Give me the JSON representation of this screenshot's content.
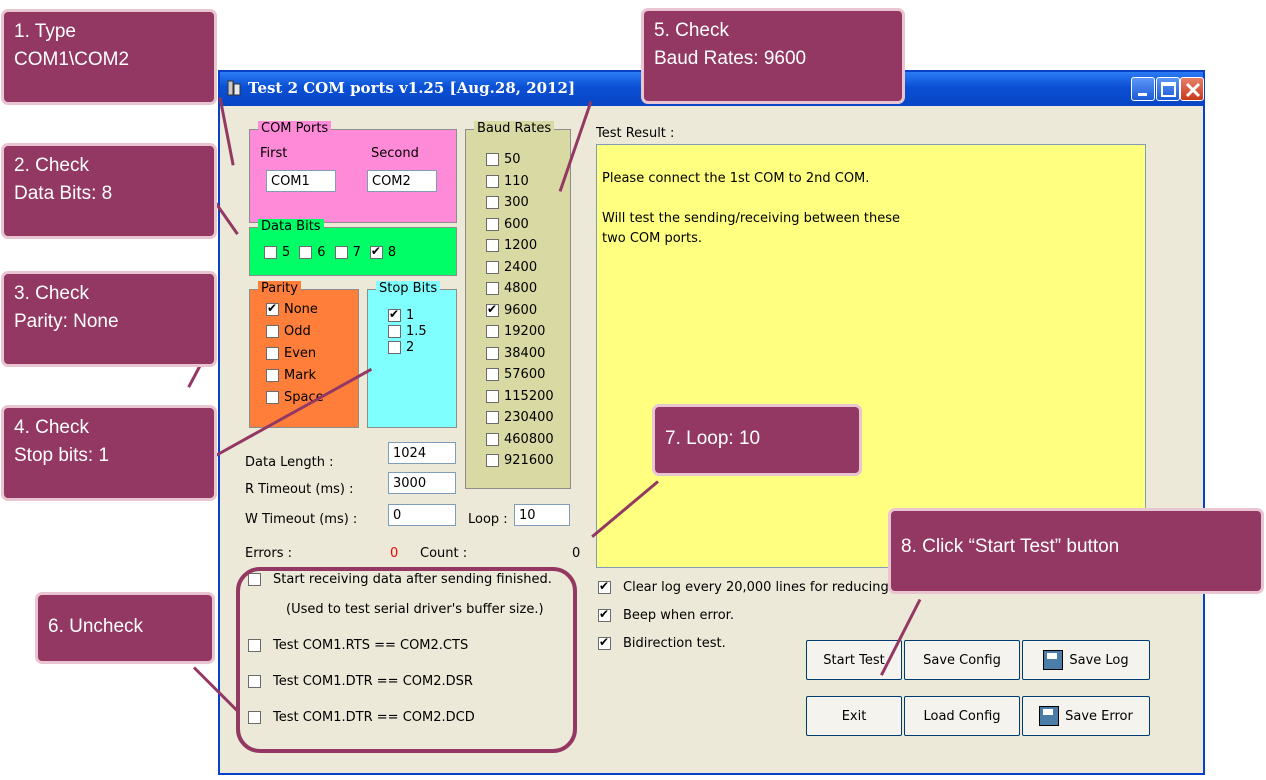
{
  "window": {
    "title": "Test 2 COM ports v1.25 [Aug.28, 2012]",
    "icon": "app-icon",
    "controls": [
      "minimize-icon",
      "maximize-icon",
      "close-icon"
    ]
  },
  "com_ports": {
    "label": "COM Ports",
    "first_label": "First",
    "second_label": "Second",
    "first_value": "COM1",
    "second_value": "COM2",
    "color": "#ff8ad8"
  },
  "data_bits": {
    "label": "Data Bits",
    "options": [
      {
        "label": "5",
        "checked": false
      },
      {
        "label": "6",
        "checked": false
      },
      {
        "label": "7",
        "checked": false
      },
      {
        "label": "8",
        "checked": true
      }
    ],
    "color": "#00ff66"
  },
  "parity": {
    "label": "Parity",
    "options": [
      {
        "label": "None",
        "checked": true
      },
      {
        "label": "Odd",
        "checked": false
      },
      {
        "label": "Even",
        "checked": false
      },
      {
        "label": "Mark",
        "checked": false
      },
      {
        "label": "Space",
        "checked": false
      }
    ],
    "color": "#ff7f3a"
  },
  "stop_bits": {
    "label": "Stop Bits",
    "options": [
      {
        "label": "1",
        "checked": true
      },
      {
        "label": "1.5",
        "checked": false
      },
      {
        "label": "2",
        "checked": false
      }
    ],
    "color": "#80ffff"
  },
  "baud_rates": {
    "label": "Baud Rates",
    "options": [
      {
        "label": "50",
        "checked": false
      },
      {
        "label": "110",
        "checked": false
      },
      {
        "label": "300",
        "checked": false
      },
      {
        "label": "600",
        "checked": false
      },
      {
        "label": "1200",
        "checked": false
      },
      {
        "label": "2400",
        "checked": false
      },
      {
        "label": "4800",
        "checked": false
      },
      {
        "label": "9600",
        "checked": true
      },
      {
        "label": "19200",
        "checked": false
      },
      {
        "label": "38400",
        "checked": false
      },
      {
        "label": "57600",
        "checked": false
      },
      {
        "label": "115200",
        "checked": false
      },
      {
        "label": "230400",
        "checked": false
      },
      {
        "label": "460800",
        "checked": false
      },
      {
        "label": "921600",
        "checked": false
      }
    ],
    "color": "#d9d9a3"
  },
  "timing": {
    "data_length_label": "Data Length :",
    "data_length_value": "1024",
    "r_timeout_label": "R Timeout (ms) :",
    "r_timeout_value": "3000",
    "w_timeout_label": "W Timeout (ms) :",
    "w_timeout_value": "0"
  },
  "loop": {
    "label": "Loop :",
    "value": "10"
  },
  "stats": {
    "errors_label": "Errors :",
    "errors_value": "0",
    "count_label": "Count :",
    "count_value": "0",
    "errors_color": "#ff0000"
  },
  "test_result": {
    "label": "Test Result :",
    "lines": [
      "",
      "Please connect the 1st COM to 2nd COM.",
      "",
      "Will test the sending/receiving between these",
      "two COM ports."
    ],
    "color": "#ffff80"
  },
  "options_left": [
    {
      "label": "Start receiving data after sending finished.",
      "checked": false
    },
    {
      "label": "(Used to test serial driver's buffer size.)",
      "checked": null
    },
    {
      "label": "Test COM1.RTS == COM2.CTS",
      "checked": false
    },
    {
      "label": "Test COM1.DTR == COM2.DSR",
      "checked": false
    },
    {
      "label": "Test COM1.DTR == COM2.DCD",
      "checked": false
    }
  ],
  "options_right": [
    {
      "label": "Clear log every 20,000  lines for reducing memory usage.",
      "checked": true
    },
    {
      "label": "Beep when error.",
      "checked": true
    },
    {
      "label": "Bidirection test.",
      "checked": true
    }
  ],
  "buttons": {
    "start_test": "Start Test",
    "save_config": "Save Config",
    "save_log": "Save Log",
    "exit": "Exit",
    "load_config": "Load Config",
    "save_error": "Save Error"
  },
  "callouts": {
    "c1": "1. Type\nCOM1\\COM2",
    "c2": "2. Check\nData Bits: 8",
    "c3": "3. Check\nParity: None",
    "c4": "4. Check\nStop bits: 1",
    "c5": "5. Check\nBaud Rates: 9600",
    "c6": "6. Uncheck",
    "c7": "7. Loop: 10",
    "c8": "8. Click “Start Test” button",
    "color": "#933863",
    "border_color": "#e9c5d1"
  }
}
